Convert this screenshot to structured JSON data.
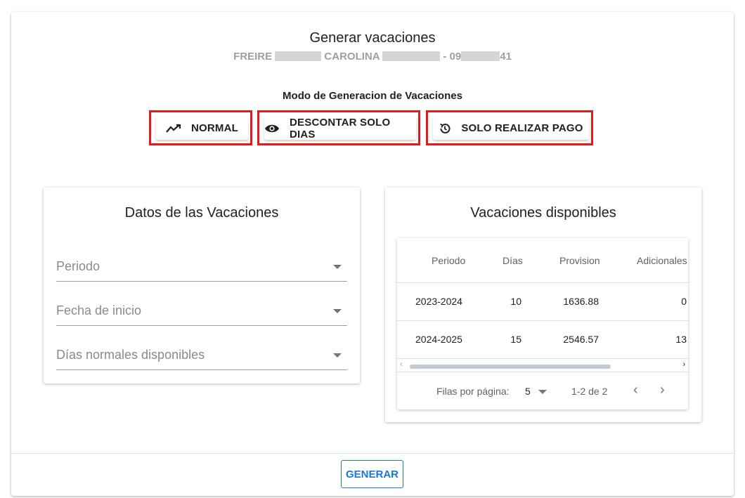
{
  "dialog": {
    "title": "Generar vacaciones",
    "employee": {
      "part1": "FREIRE",
      "part2": "CAROLINA",
      "part3": "- 09",
      "part4": "41"
    }
  },
  "mode": {
    "label": "Modo de Generacion de Vacaciones",
    "buttons": [
      {
        "label": "NORMAL",
        "icon": "trending-up-icon"
      },
      {
        "label": "DESCONTAR SOLO DIAS",
        "icon": "eye-icon"
      },
      {
        "label": "SOLO REALIZAR PAGO",
        "icon": "history-icon"
      }
    ],
    "highlight_color": "#e11b1b"
  },
  "datos": {
    "title": "Datos de las Vacaciones",
    "fields": [
      {
        "label": "Periodo"
      },
      {
        "label": "Fecha de inicio"
      },
      {
        "label": "Días normales disponibles"
      }
    ]
  },
  "disponibles": {
    "title": "Vacaciones disponibles",
    "columns": [
      "Periodo",
      "Días",
      "Provision",
      "Adicionales"
    ],
    "rows": [
      {
        "periodo": "2023-2024",
        "dias": "10",
        "provision": "1636.88",
        "adicionales": "0"
      },
      {
        "periodo": "2024-2025",
        "dias": "15",
        "provision": "2546.57",
        "adicionales": "13"
      }
    ],
    "pagination": {
      "rows_per_page_label": "Filas por página:",
      "rows_per_page": "5",
      "range": "1-2 de 2"
    }
  },
  "actions": {
    "generate_label": "GENERAR",
    "accent": "#1976d2"
  }
}
